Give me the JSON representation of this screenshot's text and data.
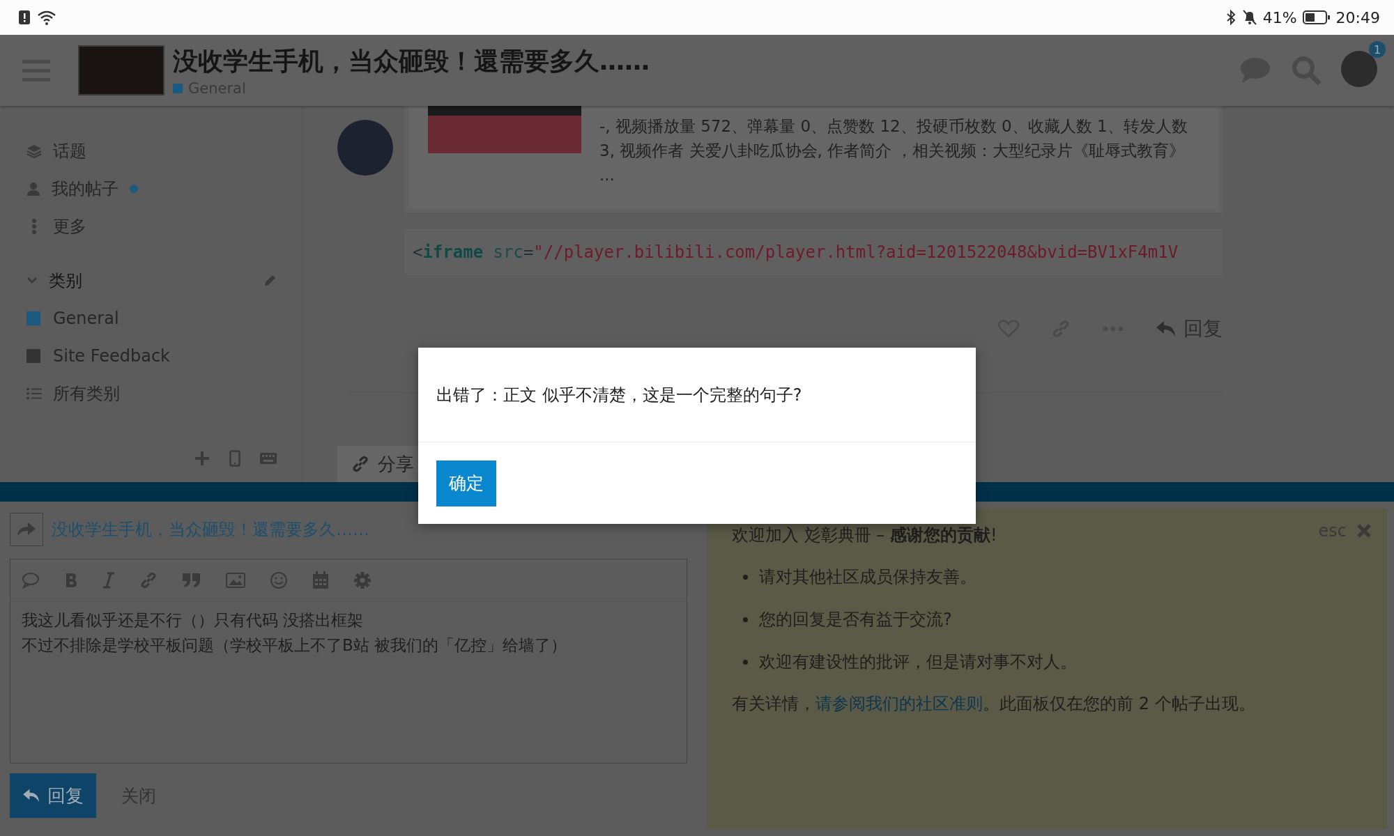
{
  "status_bar": {
    "battery": "41%",
    "time": "20:49"
  },
  "header": {
    "title": "没收学生手机，当众砸毁！還需要多久……",
    "category": {
      "label": "General",
      "color": "#1b5a80"
    },
    "notification_count": "1"
  },
  "sidebar": {
    "items": [
      {
        "kind": "topics",
        "label": "话题",
        "unread": false
      },
      {
        "kind": "posts",
        "label": "我的帖子",
        "unread": true
      },
      {
        "kind": "more",
        "label": "更多",
        "unread": false
      }
    ],
    "categories_heading": {
      "label": "类别",
      "expanded": true
    },
    "categories": [
      {
        "label": "General",
        "color": "#1b5a80"
      },
      {
        "label": "Site Feedback",
        "color": "#333333"
      }
    ],
    "all_categories": "所有类别"
  },
  "post": {
    "onebox_text": "-, 视频播放量 572、弹幕量 0、点赞数 12、投硬币枚数 0、收藏人数 1、转发人数 3, 视频作者 关爱八卦吃瓜协会, 作者简介 ，相关视频：大型纪录片《耻辱式教育》 ...",
    "code": [
      {
        "kind": "punct",
        "text": "<"
      },
      {
        "kind": "tag",
        "text": "iframe"
      },
      {
        "kind": "attr",
        "text": "src"
      },
      {
        "kind": "punct",
        "text": "="
      },
      {
        "kind": "string",
        "text": "\"//player.bilibili.com/player.html?aid=1201522048&bvid=BV1xF4m1V"
      }
    ],
    "reply_label": "回复",
    "share_label": "分享"
  },
  "composer": {
    "reply_to": "没收学生手机，当众砸毁！還需要多久……",
    "body_lines": [
      "我这儿看似乎还是不行（）只有代码 没搭出框架",
      "不过不排除是学校平板问题（学校平板上不了B站 被我们的「亿控」给墙了）"
    ],
    "submit": "回复",
    "close": "关闭"
  },
  "education_panel": {
    "esc": "esc",
    "intro": "欢迎加入 彣彰典冊 – **感谢您的贡献**!",
    "bullets": [
      "请对其他社区成员保持友善。",
      "您的回复是否有益于交流?",
      "欢迎有建设性的批评，但是请对事不对人。"
    ],
    "footer": [
      {
        "kind": "text",
        "text": "有关详情，"
      },
      {
        "kind": "link",
        "text": "请参阅我们的社区准则"
      },
      {
        "kind": "text",
        "text": "。此面板仅在您的前 2 个帖子出现。"
      }
    ]
  },
  "dialog": {
    "message": "出错了：正文 似乎不清楚，这是一个完整的句子?",
    "ok": "确定"
  }
}
